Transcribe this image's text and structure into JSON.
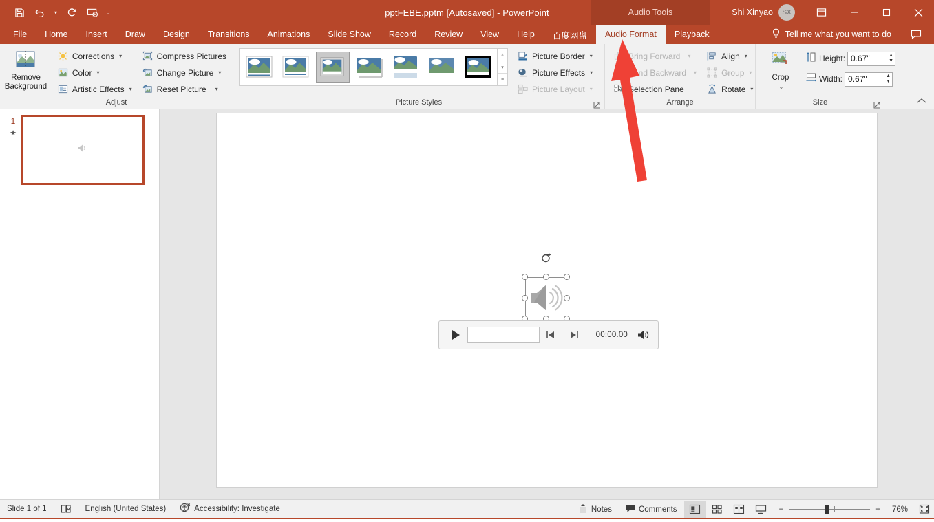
{
  "titlebar": {
    "document_title": "pptFEBE.pptm [Autosaved]  -  PowerPoint",
    "contextual_tab_group": "Audio Tools",
    "user_name": "Shi Xinyao",
    "avatar_initials": "SX",
    "qat": [
      {
        "name": "save-icon",
        "label": "Save"
      },
      {
        "name": "undo-icon",
        "label": "Undo"
      },
      {
        "name": "redo-icon",
        "label": "Redo"
      },
      {
        "name": "start-from-beginning-icon",
        "label": "Start From Beginning"
      },
      {
        "name": "customize-qat-icon",
        "label": "Customize Quick Access Toolbar"
      }
    ],
    "window_controls": {
      "ribbon_display": "Ribbon Display Options",
      "minimize": "—",
      "maximize": "□",
      "close": "✕"
    }
  },
  "tabs": [
    {
      "label": "File",
      "active": false
    },
    {
      "label": "Home",
      "active": false
    },
    {
      "label": "Insert",
      "active": false
    },
    {
      "label": "Draw",
      "active": false
    },
    {
      "label": "Design",
      "active": false
    },
    {
      "label": "Transitions",
      "active": false
    },
    {
      "label": "Animations",
      "active": false
    },
    {
      "label": "Slide Show",
      "active": false
    },
    {
      "label": "Record",
      "active": false
    },
    {
      "label": "Review",
      "active": false
    },
    {
      "label": "View",
      "active": false
    },
    {
      "label": "Help",
      "active": false
    },
    {
      "label": "百度网盘",
      "active": false
    },
    {
      "label": "Audio Format",
      "active": true
    },
    {
      "label": "Playback",
      "active": false
    }
  ],
  "tell_me": "Tell me what you want to do",
  "ribbon": {
    "adjust": {
      "label": "Adjust",
      "remove_background": "Remove\nBackground",
      "remove_background_line1": "Remove",
      "remove_background_line2": "Background",
      "items": [
        {
          "label": "Corrections",
          "caret": true,
          "disabled": false
        },
        {
          "label": "Color",
          "caret": true,
          "disabled": false
        },
        {
          "label": "Artistic Effects",
          "caret": true,
          "disabled": false
        },
        {
          "label": "Compress Pictures",
          "caret": false,
          "disabled": false
        },
        {
          "label": "Change Picture",
          "caret": true,
          "disabled": false
        },
        {
          "label": "Reset Picture",
          "caret": true,
          "disabled": false
        }
      ]
    },
    "picture_styles": {
      "label": "Picture Styles",
      "selected_index": 6,
      "styles": [
        "Simple Frame White",
        "Beveled Matte White",
        "Metal Frame",
        "Drop Shadow Rectangle",
        "Reflected Rounded Rectangle",
        "Soft Edge Rectangle",
        "Thick Black Frame"
      ],
      "side_items": [
        {
          "label": "Picture Border",
          "caret": true,
          "disabled": false
        },
        {
          "label": "Picture Effects",
          "caret": true,
          "disabled": false
        },
        {
          "label": "Picture Layout",
          "caret": true,
          "disabled": true
        }
      ]
    },
    "arrange": {
      "label": "Arrange",
      "items": [
        {
          "label": "Bring Forward",
          "caret": true,
          "disabled": true
        },
        {
          "label": "Send Backward",
          "caret": true,
          "disabled": true
        },
        {
          "label": "Selection Pane",
          "caret": false,
          "disabled": false
        },
        {
          "label": "Align",
          "caret": true,
          "disabled": false
        },
        {
          "label": "Group",
          "caret": true,
          "disabled": true
        },
        {
          "label": "Rotate",
          "caret": true,
          "disabled": false
        }
      ]
    },
    "size": {
      "label": "Size",
      "crop_label": "Crop",
      "height_label": "Height:",
      "height_value": "0.67\"",
      "width_label": "Width:",
      "width_value": "0.67\""
    }
  },
  "thumbnail_pane": {
    "slide_number": "1",
    "animation_marker": "★"
  },
  "slide": {
    "audio_player": {
      "play_label": "Play",
      "time": "00:00.00",
      "back_label": "Move Back 0.25 Seconds",
      "forward_label": "Move Forward 0.25 Seconds",
      "volume_label": "Mute/Unmute"
    }
  },
  "annotation": {
    "arrow_color": "#ef4136",
    "points_to": "Audio Format"
  },
  "statusbar": {
    "slide_status": "Slide 1 of 1",
    "language": "English (United States)",
    "accessibility": "Accessibility: Investigate",
    "notes": "Notes",
    "comments": "Comments",
    "views": [
      {
        "name": "normal-view",
        "label": "Normal",
        "active": true
      },
      {
        "name": "slide-sorter-view",
        "label": "Slide Sorter",
        "active": false
      },
      {
        "name": "reading-view",
        "label": "Reading View",
        "active": false
      },
      {
        "name": "slide-show-view",
        "label": "Slide Show",
        "active": false
      }
    ],
    "zoom_out": "−",
    "zoom_in": "+",
    "zoom_percent": "76%",
    "fit_slide": "Fit slide to current window"
  },
  "colors": {
    "brand": "#b7472a",
    "contextual_tab": "#a33f25",
    "ribbon_bg": "#f1f1f1",
    "canvas_bg": "#e6e6e6",
    "annotation_red": "#ef4136"
  }
}
